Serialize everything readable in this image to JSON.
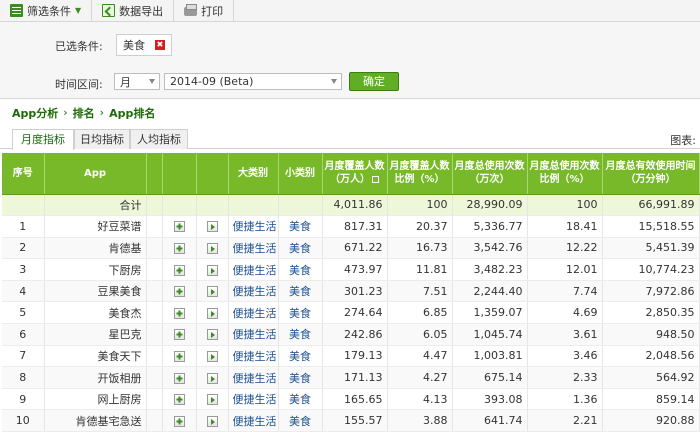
{
  "toolbar": {
    "filter_label": "筛选条件",
    "export_label": "数据导出",
    "print_label": "打印"
  },
  "filters": {
    "selected_label": "已选条件:",
    "selected_chip": "美食",
    "range_label": "时间区间:",
    "period_value": "月",
    "month_value": "2014-09 (Beta)",
    "confirm_label": "确定"
  },
  "breadcrumb": [
    "App分析",
    "排名",
    "App排名"
  ],
  "tabs": [
    "月度指标",
    "日均指标",
    "人均指标"
  ],
  "chart_label": "图表:",
  "table": {
    "headers": {
      "rank": "序号",
      "app": "App",
      "category": "大类别",
      "subcategory": "小类别",
      "coverage": "月度覆盖人数（万人）",
      "coverage_ratio": "月度覆盖人数比例（%）",
      "usage": "月度总使用次数（万次）",
      "usage_ratio": "月度总使用次数比例（%）",
      "time": "月度总有效使用时间（万分钟）"
    },
    "total": {
      "label": "合计",
      "coverage": "4,011.86",
      "coverage_ratio": "100",
      "usage": "28,990.09",
      "usage_ratio": "100",
      "time": "66,991.89"
    },
    "rows": [
      {
        "rank": "1",
        "app": "好豆菜谱",
        "category": "便捷生活",
        "subcategory": "美食",
        "coverage": "817.31",
        "coverage_ratio": "20.37",
        "usage": "5,336.77",
        "usage_ratio": "18.41",
        "time": "15,518.55"
      },
      {
        "rank": "2",
        "app": "肯德基",
        "category": "便捷生活",
        "subcategory": "美食",
        "coverage": "671.22",
        "coverage_ratio": "16.73",
        "usage": "3,542.76",
        "usage_ratio": "12.22",
        "time": "5,451.39"
      },
      {
        "rank": "3",
        "app": "下厨房",
        "category": "便捷生活",
        "subcategory": "美食",
        "coverage": "473.97",
        "coverage_ratio": "11.81",
        "usage": "3,482.23",
        "usage_ratio": "12.01",
        "time": "10,774.23"
      },
      {
        "rank": "4",
        "app": "豆果美食",
        "category": "便捷生活",
        "subcategory": "美食",
        "coverage": "301.23",
        "coverage_ratio": "7.51",
        "usage": "2,244.40",
        "usage_ratio": "7.74",
        "time": "7,972.86"
      },
      {
        "rank": "5",
        "app": "美食杰",
        "category": "便捷生活",
        "subcategory": "美食",
        "coverage": "274.64",
        "coverage_ratio": "6.85",
        "usage": "1,359.07",
        "usage_ratio": "4.69",
        "time": "2,850.35"
      },
      {
        "rank": "6",
        "app": "星巴克",
        "category": "便捷生活",
        "subcategory": "美食",
        "coverage": "242.86",
        "coverage_ratio": "6.05",
        "usage": "1,045.74",
        "usage_ratio": "3.61",
        "time": "948.50"
      },
      {
        "rank": "7",
        "app": "美食天下",
        "category": "便捷生活",
        "subcategory": "美食",
        "coverage": "179.13",
        "coverage_ratio": "4.47",
        "usage": "1,003.81",
        "usage_ratio": "3.46",
        "time": "2,048.56"
      },
      {
        "rank": "8",
        "app": "开饭相册",
        "category": "便捷生活",
        "subcategory": "美食",
        "coverage": "171.13",
        "coverage_ratio": "4.27",
        "usage": "675.14",
        "usage_ratio": "2.33",
        "time": "564.92"
      },
      {
        "rank": "9",
        "app": "网上厨房",
        "category": "便捷生活",
        "subcategory": "美食",
        "coverage": "165.65",
        "coverage_ratio": "4.13",
        "usage": "393.08",
        "usage_ratio": "1.36",
        "time": "859.14"
      },
      {
        "rank": "10",
        "app": "肯德基宅急送",
        "category": "便捷生活",
        "subcategory": "美食",
        "coverage": "155.57",
        "coverage_ratio": "3.88",
        "usage": "641.74",
        "usage_ratio": "2.21",
        "time": "920.88"
      }
    ]
  }
}
